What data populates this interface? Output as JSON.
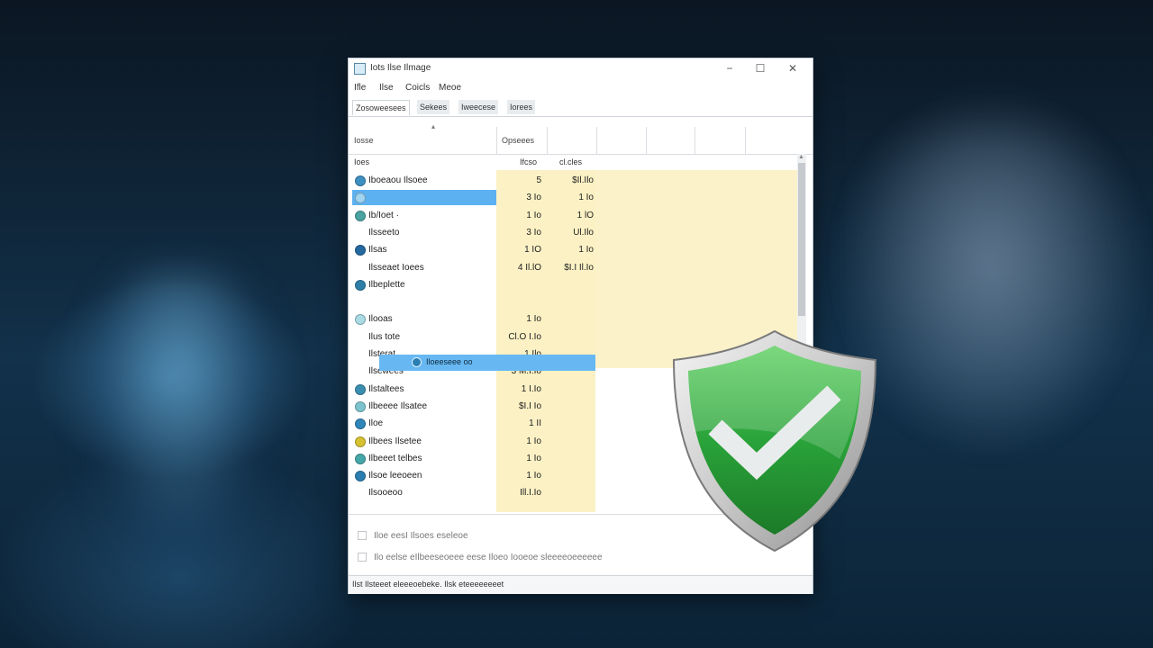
{
  "window": {
    "title": "Iots Ilse Ilmage",
    "controls": {
      "minimize": "−",
      "maximize": "☐",
      "close": "✕"
    }
  },
  "menu": [
    "Ifle",
    "Ilse",
    "Coicls",
    "Meoe"
  ],
  "tabs": [
    {
      "label": "Zosoweesees",
      "active": true
    },
    {
      "label": "Sekees",
      "active": false
    },
    {
      "label": "Iweecese",
      "active": false
    },
    {
      "label": "Iorees",
      "active": false
    }
  ],
  "table": {
    "header_name": "Iosse",
    "header_group": "Opseees",
    "sort_icon": "sort-up-icon",
    "subheaders": {
      "name": "Ioes",
      "col1": "Ifcso",
      "col2": "cl.cles"
    },
    "rows": [
      {
        "name": "Iboeaou Ilsoee",
        "v1": "5",
        "v2": "$Il.Ilo",
        "dot": "#3e8fc2"
      },
      {
        "name": "",
        "v1": "3 Io",
        "v2": "1 Io",
        "dot": "#9fd4f2",
        "selected": true
      },
      {
        "name": "Ib/Ioet ·",
        "v1": "1 Io",
        "v2": "1 lO",
        "dot": "#4aa3a0"
      },
      {
        "name": "Ilsseeto",
        "v1": "3 Io",
        "v2": "Ul.Ilo",
        "dot": ""
      },
      {
        "name": "Ilsas",
        "v1": "1 IO",
        "v2": "1 Io",
        "dot": "#2468a0"
      },
      {
        "name": "Ilsseaet Ioees",
        "v1": "4 Il.lO",
        "v2": "$I.I Il.Io",
        "dot": ""
      },
      {
        "name": "Ilbeplette",
        "v1": "",
        "v2": "",
        "dot": "#2d7fa8"
      },
      {
        "name": "",
        "v1": "",
        "v2": "",
        "dot": ""
      },
      {
        "name": "Ilooas",
        "v1": "1 Io",
        "v2": "",
        "dot": "#a9dbe5"
      },
      {
        "name": "Ilus tote",
        "v1": "Cl.O I.Io",
        "v2": "",
        "dot": ""
      },
      {
        "name": "Ilsterat",
        "v1": "1 Ilo",
        "v2": "",
        "dot": ""
      },
      {
        "name": "Ilsewees",
        "v1": "3 M.I.Io",
        "v2": "",
        "dot": ""
      },
      {
        "name": "Ilstaltees",
        "v1": "1 I.Io",
        "v2": "",
        "dot": "#3a8fb0"
      },
      {
        "name": "Ilbeeee Ilsatee",
        "v1": "$I.I Io",
        "v2": "",
        "dot": "#7dc4cf"
      },
      {
        "name": "Iloe",
        "v1": "1 II",
        "v2": "",
        "dot": "#2f86b8"
      },
      {
        "name": "Ilbees Ilsetee",
        "v1": "1 Io",
        "v2": "",
        "dot": "#d6c230"
      },
      {
        "name": "Ilbeeet telbes",
        "v1": "1 Io",
        "v2": "",
        "dot": "#46a7a8"
      },
      {
        "name": "Ilsoe leeoeen",
        "v1": "1 Io",
        "v2": "",
        "dot": "#2b7fb0"
      },
      {
        "name": "Ilsooeoo",
        "v1": "Ill.I.Io",
        "v2": "",
        "dot": ""
      }
    ],
    "drag_item": {
      "label": "Iloeeseee oo",
      "icon": "app-icon"
    }
  },
  "options": [
    "Iloe eesI Ilsoes eseleoe",
    "Ilo eelse eIlbeeseoeee eese Iloeo Iooeoe sleeeeoeeeeee"
  ],
  "status": "Ilst Ilsteeet eleeeoebeke. Ilsk eteeeeeeeet",
  "overlay": {
    "icon": "shield-check-icon"
  },
  "colors": {
    "selection": "#5cb1f0",
    "highlight_column": "#fbf1c4",
    "shield_green": "#2aa33a"
  }
}
